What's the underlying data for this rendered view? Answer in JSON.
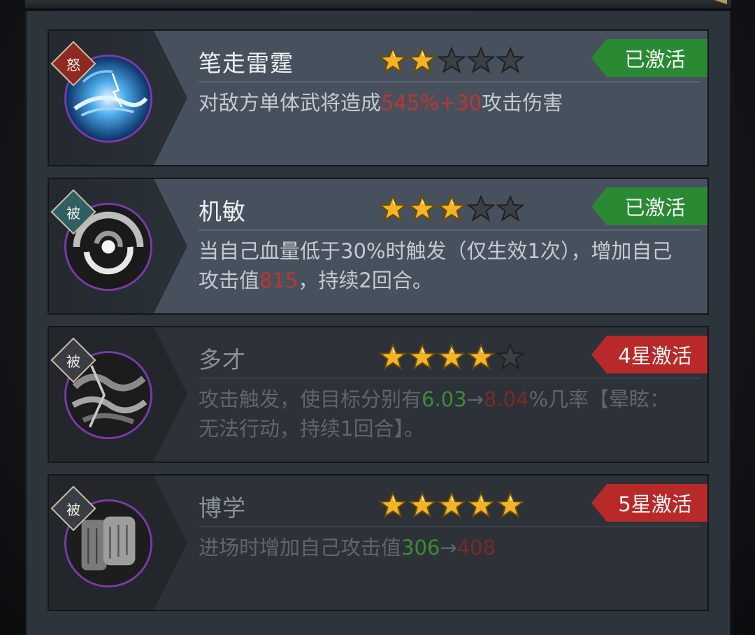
{
  "skills": [
    {
      "type_badge": "怒",
      "badge_style": "rage",
      "icon": "lightning-orb-icon",
      "name": "笔走雷霆",
      "stars_filled": 2,
      "stars_total": 5,
      "status": "已激活",
      "status_color": "#2a8a34",
      "active": true,
      "desc_segments": [
        {
          "text": "对敌方单体武将造成",
          "color": "normal"
        },
        {
          "text": "545%+30",
          "color": "red"
        },
        {
          "text": "攻击伤害",
          "color": "normal"
        }
      ]
    },
    {
      "type_badge": "被",
      "badge_style": "passive",
      "icon": "whirlwind-icon",
      "name": "机敏",
      "stars_filled": 3,
      "stars_total": 5,
      "status": "已激活",
      "status_color": "#2a8a34",
      "active": true,
      "desc_segments": [
        {
          "text": "当自己血量低于30%时触发（仅生效1次），增加自己攻击值",
          "color": "normal"
        },
        {
          "text": "815",
          "color": "red"
        },
        {
          "text": "，持续2回合。",
          "color": "normal"
        }
      ]
    },
    {
      "type_badge": "被",
      "badge_style": "passive-dim",
      "icon": "slash-vortex-icon",
      "name": "多才",
      "stars_filled": 4,
      "stars_total": 5,
      "status": "4星激活",
      "status_color": "#b8292a",
      "active": false,
      "desc_segments": [
        {
          "text": "攻击触发，使目标分别有",
          "color": "normal"
        },
        {
          "text": "6.03",
          "color": "green"
        },
        {
          "text": "→",
          "color": "normal"
        },
        {
          "text": "8.04",
          "color": "red"
        },
        {
          "text": "%几率【晕眩：无法行动，持续1回合】。",
          "color": "normal"
        }
      ]
    },
    {
      "type_badge": "被",
      "badge_style": "passive-dim",
      "icon": "scroll-icon",
      "name": "博学",
      "stars_filled": 5,
      "stars_total": 5,
      "status": "5星激活",
      "status_color": "#b8292a",
      "active": false,
      "desc_segments": [
        {
          "text": "进场时增加自己攻击值",
          "color": "normal"
        },
        {
          "text": "306",
          "color": "green"
        },
        {
          "text": "→",
          "color": "normal"
        },
        {
          "text": "408",
          "color": "red"
        }
      ]
    }
  ]
}
